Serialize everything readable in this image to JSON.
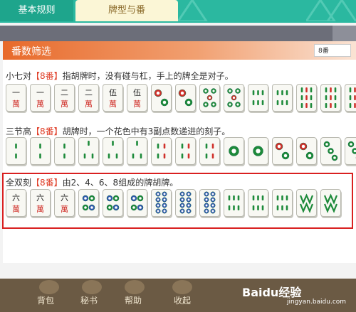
{
  "tabs": [
    {
      "label": "基本规则"
    },
    {
      "label": "牌型与番"
    }
  ],
  "section": {
    "title": "番数筛选",
    "filter": "8番"
  },
  "rows": [
    {
      "name": "小七对",
      "fan": "【8番】",
      "desc": "指胡牌时，没有碰与杠，手上的牌全是对子。",
      "tiles": [
        "c1",
        "c1",
        "c2",
        "c2",
        "c5",
        "c5",
        "d2",
        "d2",
        "d5",
        "d5",
        "b8",
        "b8",
        "b9r",
        "b9r",
        "b9r"
      ]
    },
    {
      "name": "三节高",
      "fan": "【8番】",
      "desc": "胡牌时，一个花色中有3副点数递进的刻子。",
      "tiles": [
        "b2",
        "b2",
        "b2",
        "b3",
        "b3",
        "b3",
        "b4r",
        "b4r",
        "b4r",
        "d1",
        "d1",
        "d2",
        "d2",
        "d3",
        "d3"
      ]
    },
    {
      "name": "全双刻",
      "fan": "【8番】",
      "desc": "由2、4、6、8组成的牌胡牌。",
      "tiles": [
        "c6",
        "c6",
        "c6",
        "d4",
        "d4",
        "d4",
        "d8",
        "d8",
        "d8",
        "b6",
        "b6",
        "b6",
        "b8w",
        "b8w"
      ]
    }
  ],
  "bottom": {
    "buttons": [
      "背包",
      "秘书",
      "帮助",
      "收起"
    ]
  },
  "watermark": {
    "brand": "Baidu经验",
    "url": "jingyan.baidu.com"
  },
  "colors": {
    "tab_bg": "#2bb8a0",
    "header": "#e86a2b",
    "highlight": "#d92020",
    "green": "#1d8a3a",
    "red": "#d0302a",
    "blue": "#3058b0"
  }
}
